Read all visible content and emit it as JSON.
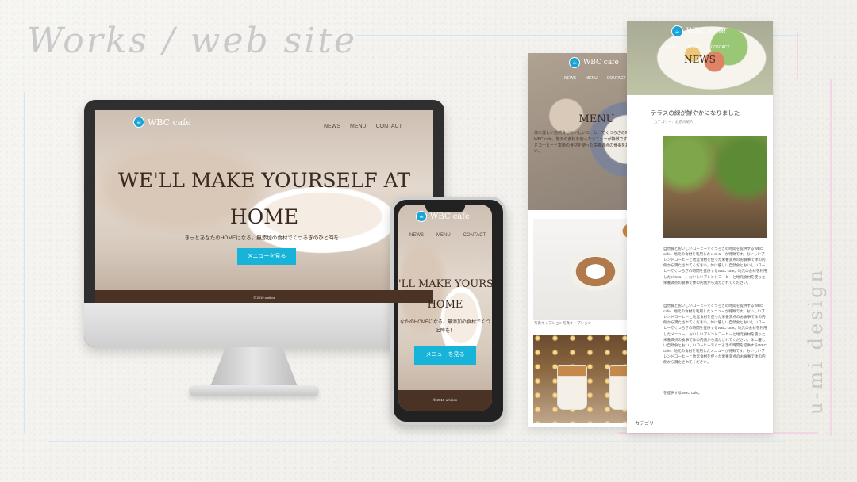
{
  "heading": "Works / web site",
  "side_brand": "u-mi design",
  "site": {
    "logo_text": "WBC cafe",
    "nav": [
      "NEWS",
      "MENU",
      "CONTACT"
    ],
    "hero_title_desktop_line1": "WE'LL MAKE YOURSELF AT",
    "hero_title_desktop_line2": "HOME",
    "hero_title_mobile_line1": "'LL MAKE YOURSELF",
    "hero_title_mobile_line2": "HOME",
    "hero_sub": "きっとあなたのHOMEになる。無添加の食材でくつろぎのひと時を！",
    "hero_sub_mobile_line1": "なたのHOMEになる。無添加の食材でくつ",
    "hero_sub_mobile_line2": "と時を！",
    "cta": "メニューを見る",
    "copyright": "© 2019 umibox"
  },
  "menu_page": {
    "title": "MENU",
    "text": "体に優しい自然食とおいしいコーヒーでくつろぎの時間を提供するWBC cafe。地元の食材を使ったメニューが特徴です。おいしいブレンドコーヒーと季節の食材を使った栄養満点の食事をお楽しみください。",
    "caption": "写真キャプション写真キャプション"
  },
  "news_page": {
    "title": "NEWS",
    "headline": "テラスの緑が鮮やかになりました",
    "category_meta": "カテゴリー：お店の紹介",
    "paragraph1": "自然食とおいしいコーヒーでくつろぎの時間を提供するWBC cafe。地元の食材を利用したメニューが特徴です。おいしいブレンドコーヒーと地元食材を使った栄養満点のお食事で体の内側から満たされてください。体に優しい自然食とおいしいコーヒーでくつろぎの時間を提供するWBC cafe。地元の食材を利用したメニュー。おいしいブレンドコーヒーと地元食材を使った栄養満点の食事で体の内側から満たされてください。",
    "paragraph2": "自然食とおいしいコーヒーでくつろぎの時間を提供するWBC cafe。地元の食材を利用したメニューが特徴です。おいしいブレンドコーヒーと地元食材を使った栄養満点のお食事で体の内側から満たされてください。体に優しい自然食とおいしいコーヒーでくつろぎの時間を提供するWBC cafe。地元の食材を利用したメニュー。おいしいブレンドコーヒーと地元食材を使った栄養満点の食事で体の内側から満たされてください。体に優しい自然食とおいしいコーヒーでくつろぎの時間を提供するWBC cafe。地元の食材を利用したメニューが特徴です。おいしいブレンドコーヒーと地元食材を使った栄養満点のお食事で体の内側から満たされてください。",
    "paragraph3": "を提供するWBC cafe。",
    "category_label": "カテゴリー"
  },
  "colors": {
    "accent": "#17b3d9",
    "footer": "#4a3324",
    "line_blue": "#cfe6f3",
    "line_pink": "#f3d6e6"
  }
}
